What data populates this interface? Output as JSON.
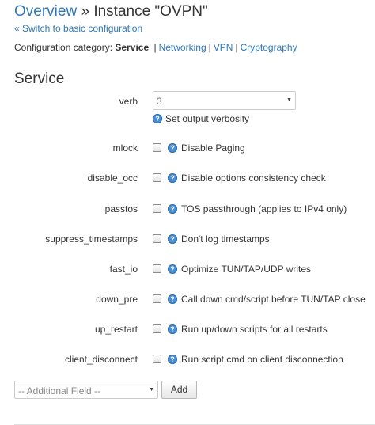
{
  "header": {
    "overview_link": "Overview",
    "separator": "»",
    "title": "Instance \"OVPN\""
  },
  "back_link": "« Switch to basic configuration",
  "category": {
    "label": "Configuration category:",
    "current": "Service",
    "separator": "|",
    "links": [
      "Networking",
      "VPN",
      "Cryptography"
    ]
  },
  "section_title": "Service",
  "verb": {
    "label": "verb",
    "value": "3",
    "help": "Set output verbosity"
  },
  "options": [
    {
      "name": "mlock",
      "desc": "Disable Paging",
      "checked": false
    },
    {
      "name": "disable_occ",
      "desc": "Disable options consistency check",
      "checked": false
    },
    {
      "name": "passtos",
      "desc": "TOS passthrough (applies to IPv4 only)",
      "checked": false
    },
    {
      "name": "suppress_timestamps",
      "desc": "Don't log timestamps",
      "checked": false
    },
    {
      "name": "fast_io",
      "desc": "Optimize TUN/TAP/UDP writes",
      "checked": false
    },
    {
      "name": "down_pre",
      "desc": "Call down cmd/script before TUN/TAP close",
      "checked": false
    },
    {
      "name": "up_restart",
      "desc": "Run up/down scripts for all restarts",
      "checked": false
    },
    {
      "name": "client_disconnect",
      "desc": "Run script cmd on client disconnection",
      "checked": false
    }
  ],
  "add_field": {
    "placeholder": "-- Additional Field --",
    "button": "Add"
  },
  "icons": {
    "help": "help-icon",
    "dropdown": "chevron-down-icon"
  },
  "colors": {
    "link": "#2f77b8",
    "help_icon": "#4a8ed4"
  }
}
